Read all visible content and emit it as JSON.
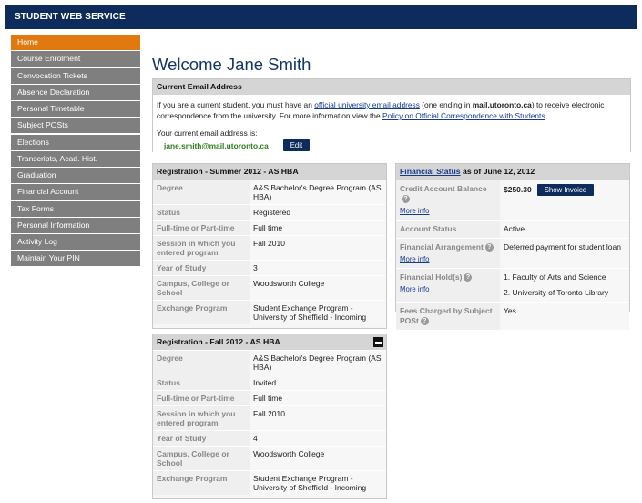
{
  "header": {
    "title": "STUDENT WEB SERVICE"
  },
  "sidebar": {
    "items": [
      {
        "label": "Home"
      },
      {
        "label": "Course Enrolment"
      },
      {
        "label": "Convocation Tickets"
      },
      {
        "label": "Absence Declaration"
      },
      {
        "label": "Personal Timetable"
      },
      {
        "label": "Subject POSts"
      },
      {
        "label": "Elections"
      },
      {
        "label": "Transcripts, Acad. Hist."
      },
      {
        "label": "Graduation"
      },
      {
        "label": "Financial Account"
      },
      {
        "label": "Tax Forms"
      },
      {
        "label": "Personal Information"
      },
      {
        "label": "Activity Log"
      },
      {
        "label": "Maintain Your PIN"
      }
    ]
  },
  "page": {
    "title": "Welcome Jane Smith"
  },
  "email": {
    "header": "Current Email Address",
    "text_1": "If you are a current student, you must have an ",
    "link_1": "official university email address",
    "text_2": " (one ending in ",
    "domain": "mail.utoronto.ca",
    "text_3": ") to receive electronic correspondence from the university. For more information view the ",
    "link_2": "Policy on Official Correspondence with Students",
    "text_4": ".",
    "current_label": "Your current email address is:",
    "address": "jane.smith@mail.utoronto.ca",
    "edit_label": "Edit"
  },
  "registration_summer": {
    "header": "Registration - Summer 2012 - AS HBA",
    "rows": [
      {
        "k": "Degree",
        "v": "A&S Bachelor's Degree Program (AS HBA)"
      },
      {
        "k": "Status",
        "v": "Registered"
      },
      {
        "k": "Full-time or Part-time",
        "v": "Full time"
      },
      {
        "k": "Session in which you entered program",
        "v": "Fall 2010"
      },
      {
        "k": "Year of Study",
        "v": "3"
      },
      {
        "k": "Campus, College or School",
        "v": "Woodsworth College"
      },
      {
        "k": "Exchange Program",
        "v": "Student Exchange Program - University of Sheffield - Incoming"
      }
    ]
  },
  "registration_fall": {
    "header": "Registration - Fall 2012 - AS HBA",
    "rows": [
      {
        "k": "Degree",
        "v": "A&S Bachelor's Degree Program (AS HBA)"
      },
      {
        "k": "Status",
        "v": "Invited"
      },
      {
        "k": "Full-time or Part-time",
        "v": "Full time"
      },
      {
        "k": "Session in which you entered program",
        "v": "Fall 2010"
      },
      {
        "k": "Year of Study",
        "v": "4"
      },
      {
        "k": "Campus, College or School",
        "v": "Woodsworth College"
      },
      {
        "k": "Exchange Program",
        "v": "Student Exchange Program - University of Sheffield - Incoming"
      }
    ]
  },
  "financial": {
    "header_link": "Financial Status",
    "header_rest": " as of June 12, 2012",
    "more_info": "More info",
    "help_glyph": "?",
    "credit_label": "Credit Account Balance",
    "credit_value": "$250.30",
    "show_invoice": "Show Invoice",
    "account_status_label": "Account Status",
    "account_status_value": "Active",
    "arrangement_label": "Financial Arrangement",
    "arrangement_value": "Deferred payment for student loan",
    "holds_label": "Financial Hold(s)",
    "hold_1": "1. Faculty of Arts and Science",
    "hold_2": "2. University of Toronto Library",
    "fees_label": "Fees Charged by Subject POSt",
    "fees_value": "Yes"
  }
}
